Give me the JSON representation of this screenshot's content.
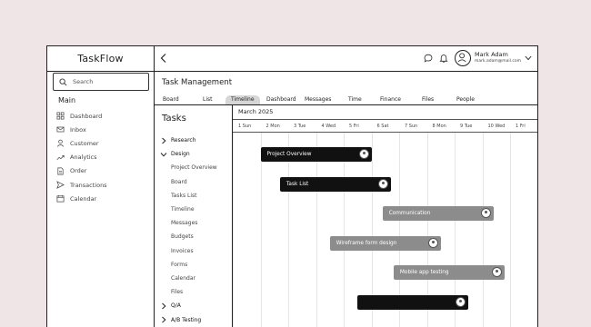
{
  "app": {
    "name": "TaskFlow"
  },
  "sidebar": {
    "search_placeholder": "Search",
    "section_title": "Main",
    "items": [
      {
        "label": "Dashboard",
        "icon": "grid-icon"
      },
      {
        "label": "Inbox",
        "icon": "mail-icon"
      },
      {
        "label": "Customer",
        "icon": "user-icon"
      },
      {
        "label": "Analytics",
        "icon": "trend-icon"
      },
      {
        "label": "Order",
        "icon": "document-icon"
      },
      {
        "label": "Transactions",
        "icon": "send-icon"
      },
      {
        "label": "Calendar",
        "icon": "calendar-icon"
      }
    ]
  },
  "header": {
    "user_name": "Mark Adam",
    "user_email": "mark.adam@mail.com"
  },
  "page": {
    "title": "Task Management"
  },
  "tabs": [
    {
      "label": "Board"
    },
    {
      "label": "List"
    },
    {
      "label": "Timeline",
      "active": true
    },
    {
      "label": "Dashboard"
    },
    {
      "label": "Messages"
    },
    {
      "label": "Time"
    },
    {
      "label": "Finance"
    },
    {
      "label": "Files"
    },
    {
      "label": "People"
    }
  ],
  "tasks": {
    "title": "Tasks",
    "tree": [
      {
        "label": "Research",
        "type": "group",
        "expanded": false
      },
      {
        "label": "Design",
        "type": "group",
        "expanded": true
      },
      {
        "label": "Project Overview",
        "type": "child"
      },
      {
        "label": "Board",
        "type": "child"
      },
      {
        "label": "Tasks List",
        "type": "child"
      },
      {
        "label": "Timeline",
        "type": "child"
      },
      {
        "label": "Messages",
        "type": "child"
      },
      {
        "label": "Budgets",
        "type": "child"
      },
      {
        "label": "Invoices",
        "type": "child"
      },
      {
        "label": "Forms",
        "type": "child"
      },
      {
        "label": "Calendar",
        "type": "child"
      },
      {
        "label": "Files",
        "type": "child"
      },
      {
        "label": "Q/A",
        "type": "group",
        "expanded": false
      },
      {
        "label": "A/B Testing",
        "type": "group",
        "expanded": false
      }
    ]
  },
  "timeline": {
    "month": "March 2025",
    "days": [
      "1 Sun",
      "2 Mon",
      "3 Tue",
      "4 Wed",
      "5 Fri",
      "6 Sat",
      "7 Sun",
      "8 Mon",
      "9 Tue",
      "10 Wed",
      "1 Fri"
    ],
    "bars": [
      {
        "label": "Project Overview",
        "style": "dark",
        "start": 1.0,
        "end": 5.0,
        "row": 0
      },
      {
        "label": "Task List",
        "style": "dark",
        "start": 1.7,
        "end": 5.7,
        "row": 1
      },
      {
        "label": "Communication",
        "style": "gray",
        "start": 5.4,
        "end": 9.4,
        "row": 2
      },
      {
        "label": "Wireframe form design",
        "style": "gray",
        "start": 3.5,
        "end": 7.5,
        "row": 3
      },
      {
        "label": "Mobile app testing",
        "style": "gray",
        "start": 5.8,
        "end": 9.8,
        "row": 4
      },
      {
        "label": "",
        "style": "dark",
        "start": 4.5,
        "end": 8.5,
        "row": 5
      }
    ]
  },
  "colors": {
    "background": "#efe4e6",
    "bar_dark": "#111111",
    "bar_gray": "#8c8c8c"
  }
}
